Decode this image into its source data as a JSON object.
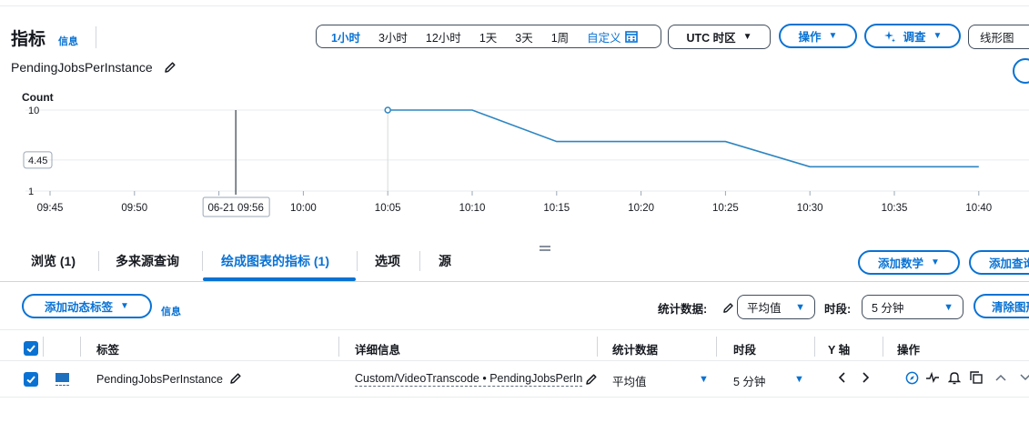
{
  "header": {
    "title": "指标",
    "info": "信息",
    "time_ranges": [
      "1小时",
      "3小时",
      "12小时",
      "1天",
      "3天",
      "1周"
    ],
    "active_range": "1小时",
    "custom": "自定义",
    "timezone": "UTC 时区",
    "actions": "操作",
    "investigate": "调查",
    "chart_type": "线形图"
  },
  "metric_title": "PendingJobsPerInstance",
  "chart_data": {
    "type": "line",
    "ylabel": "Count",
    "y_ticks": [
      "10",
      "4.45",
      "1"
    ],
    "x_ticks": [
      "09:45",
      "09:50",
      "09",
      "10:00",
      "10:05",
      "10:10",
      "10:15",
      "10:20",
      "10:25",
      "10:30",
      "10:35",
      "10:40"
    ],
    "cursor_label": "06-21 09:56",
    "series": [
      {
        "x": [
          "10:05",
          "10:10",
          "10:15",
          "10:20",
          "10:25",
          "10:30",
          "10:35",
          "10:40"
        ],
        "y": [
          10,
          10,
          6.5,
          6.5,
          6.5,
          3.7,
          3.7,
          3.7
        ]
      }
    ],
    "ylim": [
      1,
      10
    ],
    "colors": {
      "line": "#2e86c1",
      "grid": "#e9ebed",
      "axis": "#9ba7b6"
    }
  },
  "tabs": [
    {
      "label": "浏览 (1)"
    },
    {
      "label": "多来源查询"
    },
    {
      "label": "绘成图表的指标 (1)"
    },
    {
      "label": "选项"
    },
    {
      "label": "源"
    }
  ],
  "tabs_right": {
    "add_math": "添加数学",
    "add_query": "添加查询"
  },
  "toolbar": {
    "add_dynamic_label": "添加动态标签",
    "info": "信息",
    "stat_label": "统计数据:",
    "stat_value": "平均值",
    "period_label": "时段:",
    "period_value": "5 分钟",
    "clear": "清除图形"
  },
  "table": {
    "headers": [
      "标签",
      "详细信息",
      "统计数据",
      "时段",
      "Y 轴",
      "操作"
    ],
    "rows": [
      {
        "label": "PendingJobsPerInstance",
        "details": "Custom/VideoTranscode • PendingJobsPerInstance",
        "stat": "平均值",
        "period": "5 分钟",
        "color": "#1f6fbf"
      }
    ]
  },
  "colors": {
    "accent": "#0972d3",
    "text": "#16191f",
    "border": "#414d5c"
  }
}
